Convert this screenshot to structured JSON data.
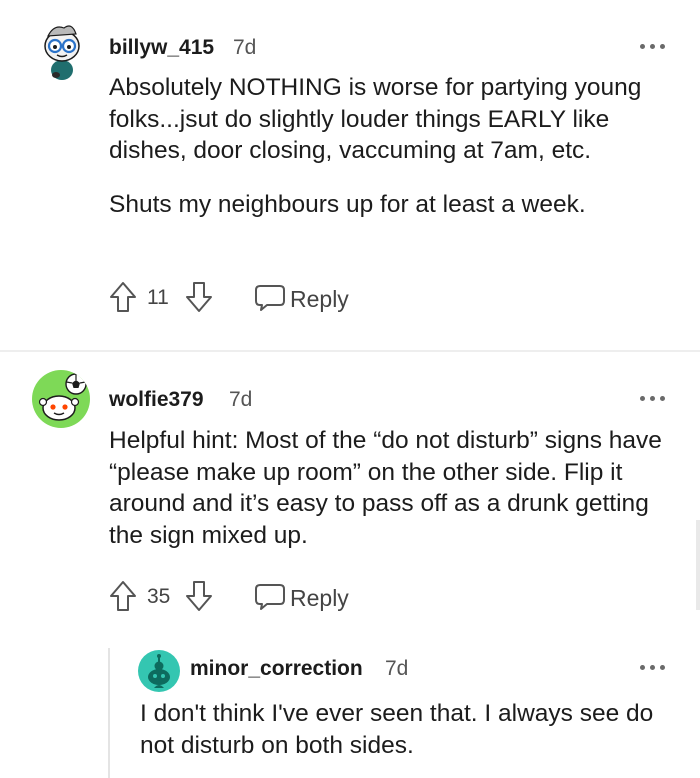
{
  "comments": [
    {
      "username": "billyw_415",
      "time": "7d",
      "paragraphs": [
        "Absolutely NOTHING is worse for partying young folks...jsut do slightly louder things EARLY like dishes, door closing, vaccuming at 7am, etc.",
        "Shuts my neighbours up for at least a week."
      ],
      "score": "11",
      "reply_label": "Reply",
      "avatar_icon": "snoo-glasses-avatar-icon"
    },
    {
      "username": "wolfie379",
      "time": "7d",
      "paragraphs": [
        "Helpful hint: Most of the “do not disturb” signs have “please make up room” on the other side. Flip it around and it’s easy to pass off as a drunk getting the sign mixed up."
      ],
      "score": "35",
      "reply_label": "Reply",
      "avatar_icon": "snoo-soccer-avatar-icon"
    },
    {
      "username": "minor_correction",
      "time": "7d",
      "paragraphs": [
        "I don't think I've ever seen that. I always see do not disturb on both sides."
      ],
      "avatar_icon": "snoo-default-avatar-icon"
    }
  ],
  "colors": {
    "text": "#1c1c1c",
    "meta": "#555555",
    "divider": "#eeeeee",
    "avatar_green": "#7ed957",
    "avatar_teal": "#34c6b1"
  }
}
